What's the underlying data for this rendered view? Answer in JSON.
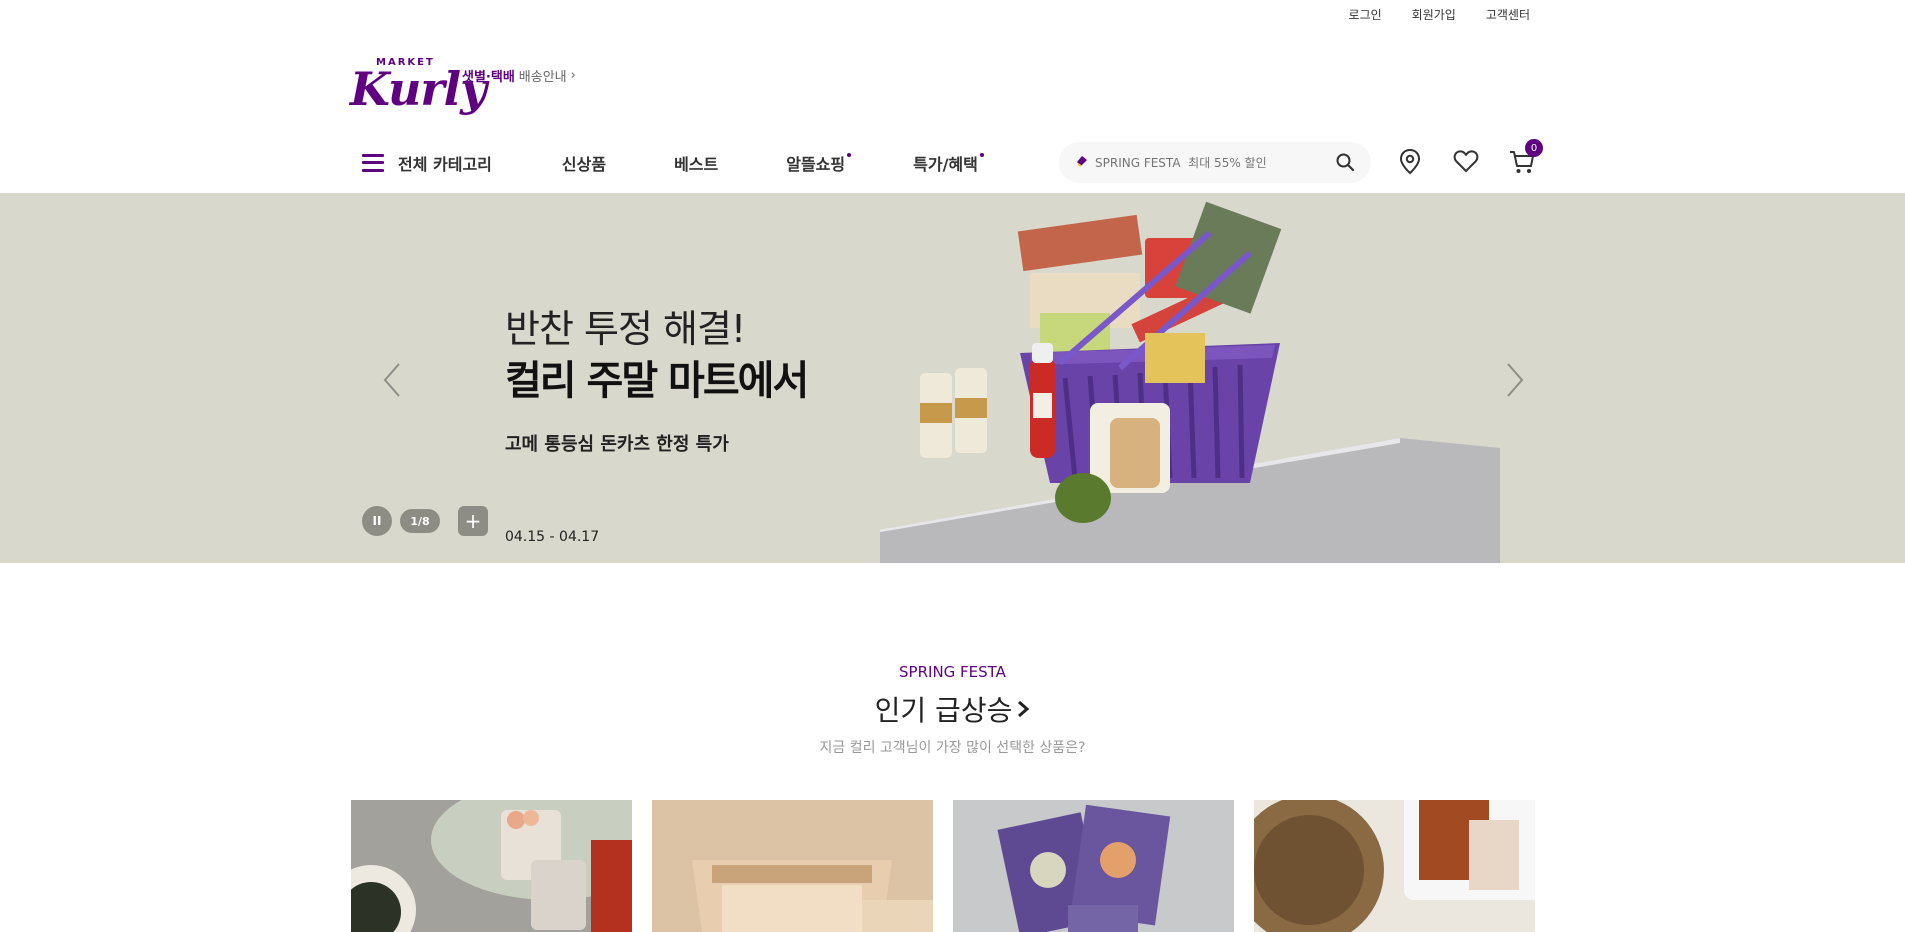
{
  "util_links": [
    "로그인",
    "회원가입",
    "고객센터"
  ],
  "logo": {
    "market": "MARKET",
    "kurly": "Kurly"
  },
  "delivery": {
    "strong": "샛별·택배",
    "guide": "배송안내",
    "chevron": "›"
  },
  "gnb": {
    "category": "전체 카테고리",
    "menu": [
      "신상품",
      "베스트",
      "알뜰쇼핑",
      "특가/혜택"
    ]
  },
  "search": {
    "placeholder": "SPRING FESTA  최대 55% 할인"
  },
  "cart_count": "0",
  "banner": {
    "line1": "반찬 투정 해결!",
    "line2": "컬리 주말 마트에서",
    "sub": "고메 통등심 돈카츠 한정 특가",
    "date": "04.15 - 04.17",
    "pause": "II",
    "page": "1/8",
    "plus": "+",
    "background": "#d9d8cd"
  },
  "section": {
    "eyebrow": "SPRING FESTA",
    "title": "인기 급상승",
    "desc": "지금 컬리 고객님이 가장 많이 선택한 상품은?"
  },
  "colors": {
    "brand": "#5f0080"
  }
}
